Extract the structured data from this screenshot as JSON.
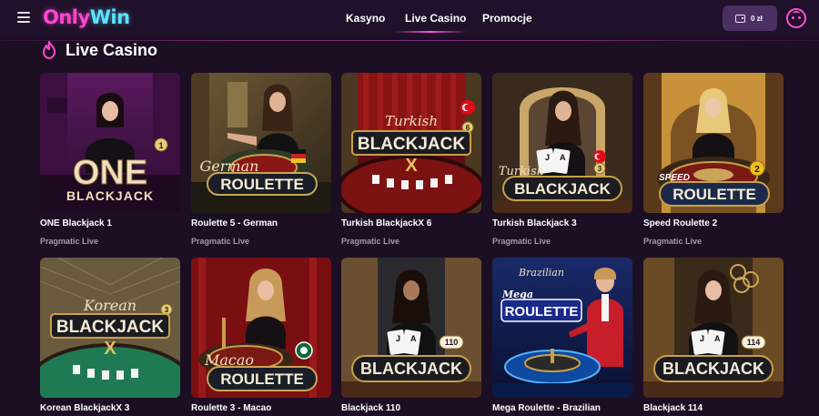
{
  "header": {
    "logo_only": "Only",
    "logo_win": "Win",
    "nav": {
      "kasyno": "Kasyno",
      "live_casino": "Live Casino",
      "promocje": "Promocje"
    },
    "wallet_balance": "0 zł"
  },
  "section": {
    "title": "Live Casino"
  },
  "games": [
    {
      "title": "ONE Blackjack 1",
      "provider": "Pragmatic Live",
      "art_top": "ONE",
      "art_bottom": "BLACKJACK",
      "badge": "1"
    },
    {
      "title": "Roulette 5 - German",
      "provider": "Pragmatic Live",
      "art_script": "German",
      "art_bottom": "ROULETTE"
    },
    {
      "title": "Turkish BlackjackX 6",
      "provider": "Pragmatic Live",
      "art_script": "Turkish",
      "art_main": "BLACKJACK",
      "art_x": "X",
      "badge": "6"
    },
    {
      "title": "Turkish Blackjack 3",
      "provider": "Pragmatic Live",
      "art_script": "Turkish",
      "art_bottom": "BLACKJACK",
      "badge": "3"
    },
    {
      "title": "Speed Roulette 2",
      "provider": "Pragmatic Live",
      "art_script": "SPEED",
      "art_bottom": "ROULETTE",
      "badge": "2"
    },
    {
      "title": "Korean BlackjackX 3",
      "provider": "",
      "art_script": "Korean",
      "art_main": "BLACKJACK",
      "art_x": "X",
      "badge": "3"
    },
    {
      "title": "Roulette 3 - Macao",
      "provider": "",
      "art_script": "Macao",
      "art_bottom": "ROULETTE"
    },
    {
      "title": "Blackjack 110",
      "provider": "",
      "art_bottom": "BLACKJACK",
      "badge": "110"
    },
    {
      "title": "Mega Roulette - Brazilian",
      "provider": "",
      "art_script": "Brazilian",
      "art_mega": "Mega",
      "art_main": "ROULETTE"
    },
    {
      "title": "Blackjack 114",
      "provider": "",
      "art_bottom": "BLACKJACK",
      "badge": "114"
    }
  ],
  "colors": {
    "background": "#1c0f24",
    "accent_pink": "#ff47d0",
    "accent_cyan": "#5ce1ff",
    "wallet_bg": "#4a2f63",
    "provider_text": "#a79cae"
  },
  "icons": {
    "menu": "hamburger-icon",
    "section": "flame-icon",
    "wallet": "wallet-icon",
    "avatar": "user-face-icon"
  }
}
